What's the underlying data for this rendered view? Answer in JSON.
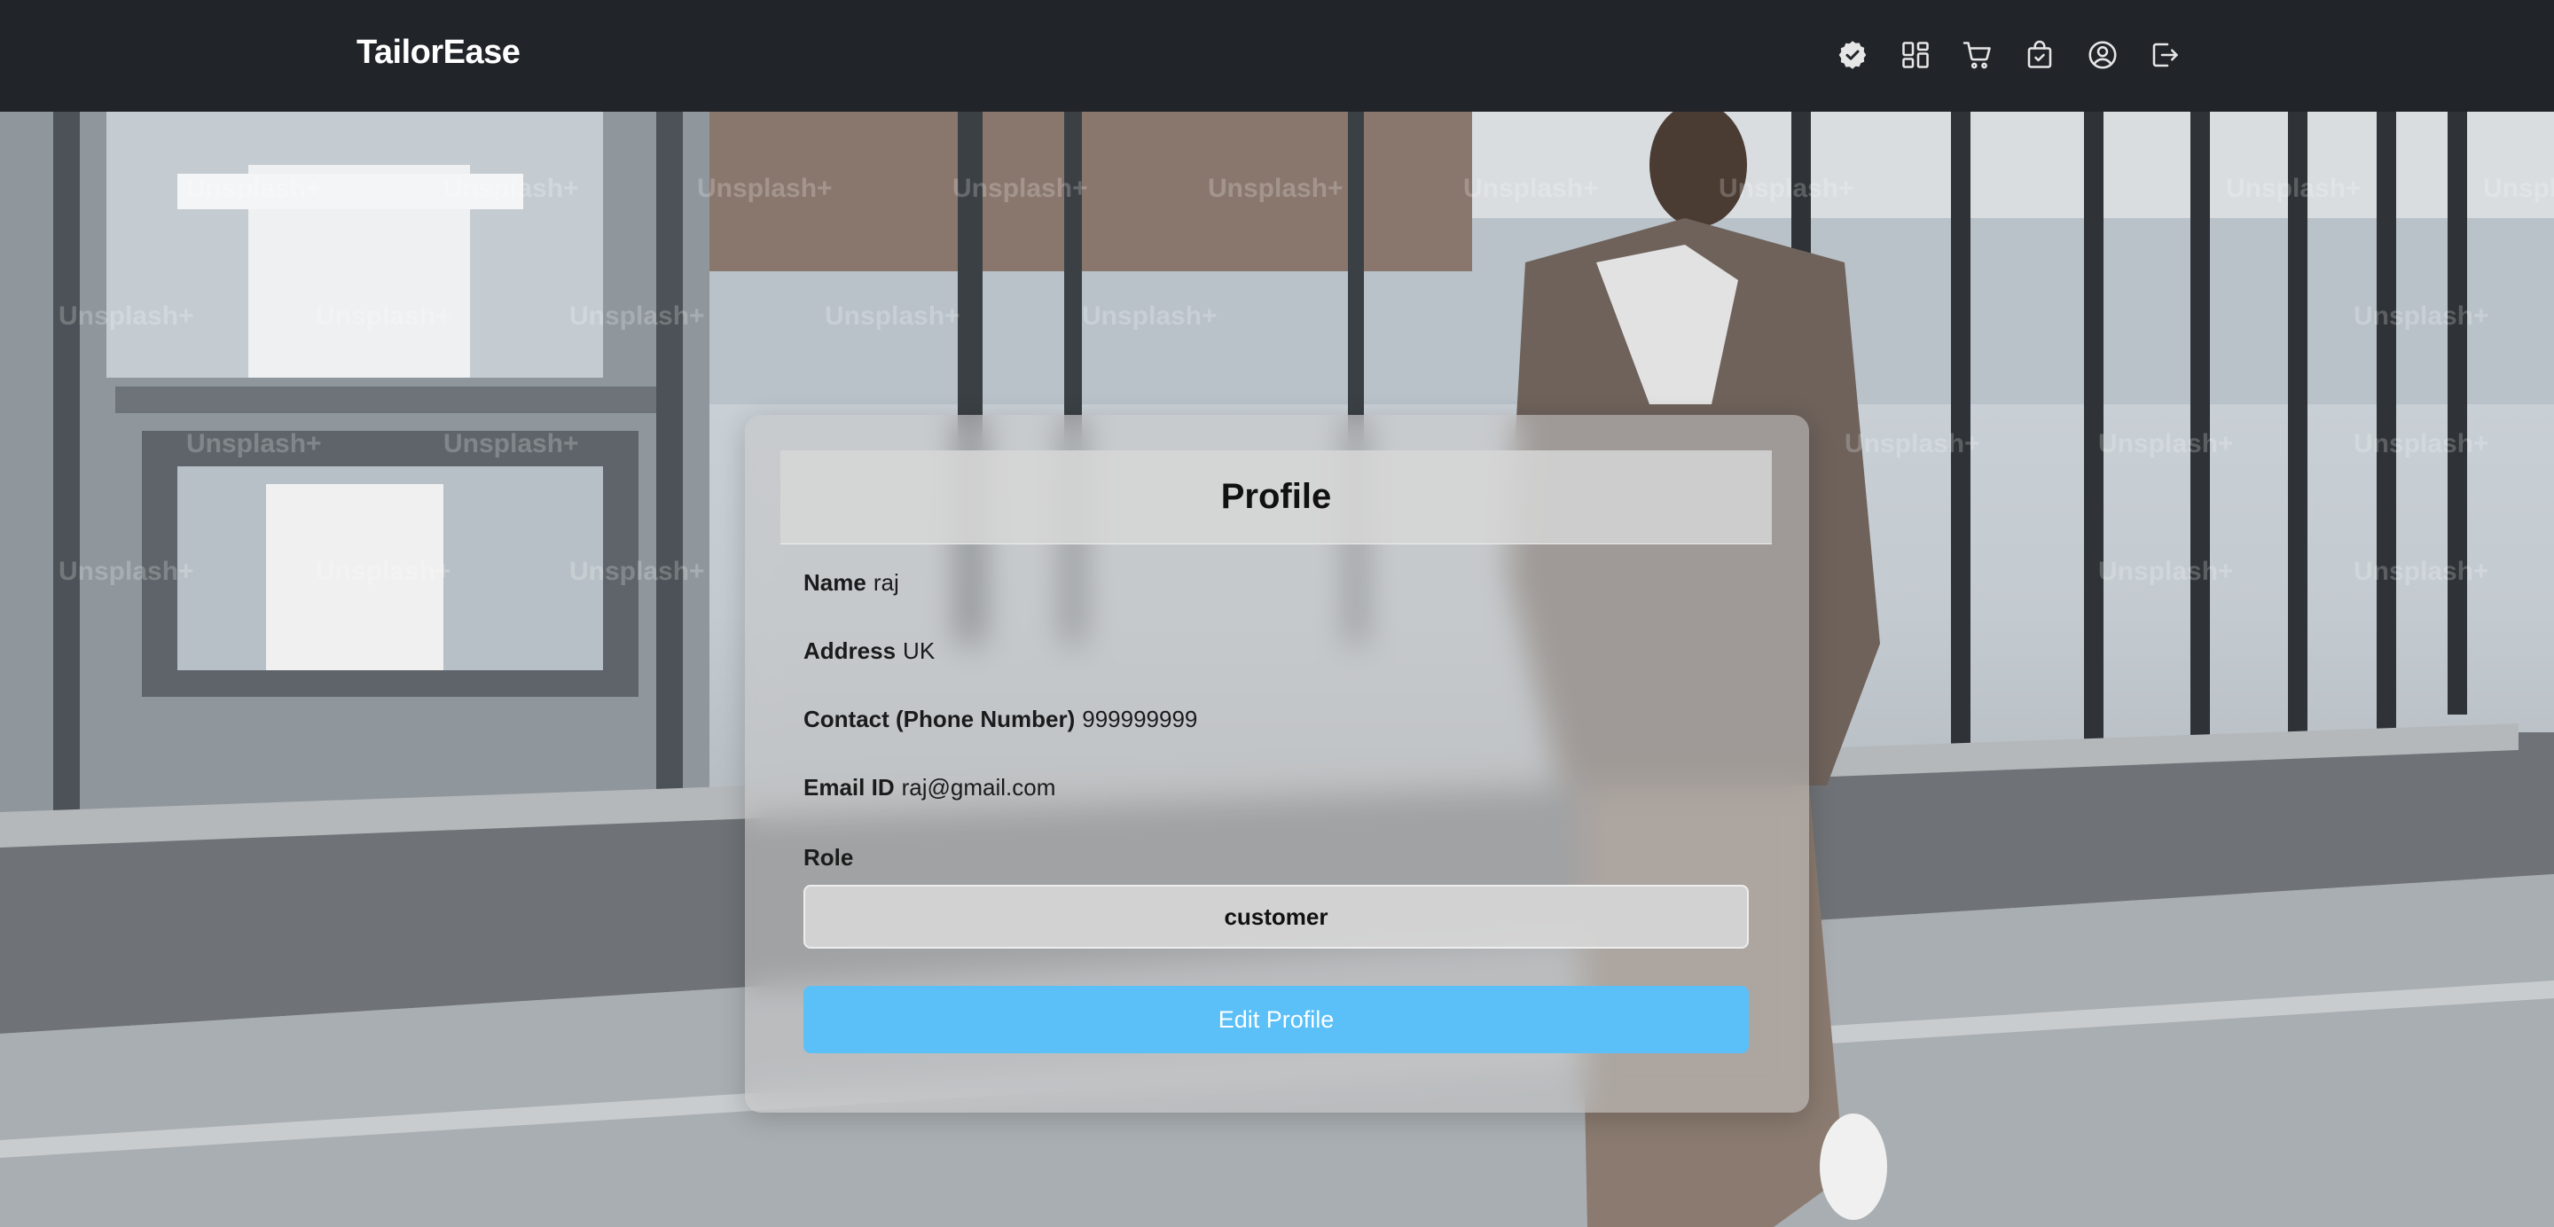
{
  "navbar": {
    "brand": "TailorEase",
    "icons": [
      {
        "name": "verified-badge-icon"
      },
      {
        "name": "dashboard-grid-icon"
      },
      {
        "name": "cart-icon"
      },
      {
        "name": "shopping-bag-check-icon"
      },
      {
        "name": "user-profile-icon"
      },
      {
        "name": "logout-icon"
      }
    ]
  },
  "background": {
    "watermark_text": "Unsplash+"
  },
  "profile": {
    "title": "Profile",
    "name_label": "Name",
    "name_value": "raj",
    "address_label": "Address",
    "address_value": "UK",
    "contact_label": "Contact (Phone Number)",
    "contact_value": "999999999",
    "email_label": "Email ID",
    "email_value": "raj@gmail.com",
    "role_label": "Role",
    "role_value": "customer",
    "edit_button": "Edit Profile"
  },
  "colors": {
    "navbar_bg": "#212429",
    "button_primary": "#5bc0f8",
    "text_white": "#ffffff"
  }
}
